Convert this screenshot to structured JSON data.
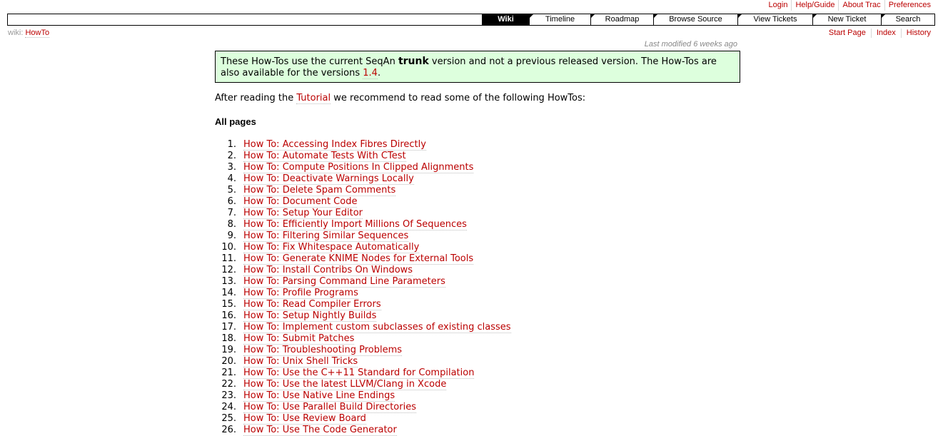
{
  "metanav": [
    {
      "label": "Login"
    },
    {
      "label": "Help/Guide"
    },
    {
      "label": "About Trac"
    },
    {
      "label": "Preferences"
    }
  ],
  "mainnav": [
    {
      "label": "Wiki",
      "active": true,
      "width": 66
    },
    {
      "label": "Timeline",
      "width": 86
    },
    {
      "label": "Roadmap",
      "width": 88
    },
    {
      "label": "Browse Source",
      "width": 118
    },
    {
      "label": "View Tickets",
      "width": 105
    },
    {
      "label": "New Ticket",
      "width": 96
    },
    {
      "label": "Search",
      "width": 75
    }
  ],
  "ctxtnav": {
    "prefix": "wiki:",
    "page": "HowTo",
    "links": [
      {
        "label": "Start Page"
      },
      {
        "label": "Index"
      },
      {
        "label": "History"
      }
    ]
  },
  "last_modified": "Last modified 6 weeks ago",
  "notice": {
    "text1": "These How-Tos use the current SeqAn ",
    "bold": "trunk",
    "text2": " version and not a previous released version. The How-Tos are also available for the versions ",
    "link": "1.4",
    "text3": "."
  },
  "intro": {
    "text1": "After reading the ",
    "link": "Tutorial",
    "text2": " we recommend to read some of the following HowTos:"
  },
  "all_pages_heading": "All pages",
  "howtos": [
    "How To: Accessing Index Fibres Directly",
    "How To: Automate Tests With CTest",
    "How To: Compute Positions In Clipped Alignments",
    "How To: Deactivate Warnings Locally",
    "How To: Delete Spam Comments",
    "How To: Document Code",
    "How To: Setup Your Editor",
    "How To: Efficiently Import Millions Of Sequences",
    "How To: Filtering Similar Sequences",
    "How To: Fix Whitespace Automatically",
    "How To: Generate KNIME Nodes for External Tools",
    "How To: Install Contribs On Windows",
    "How To: Parsing Command Line Parameters",
    "How To: Profile Programs",
    "How To: Read Compiler Errors",
    "How To: Setup Nightly Builds",
    "How To: Implement custom subclasses of existing classes",
    "How To: Submit Patches",
    "How To: Troubleshooting Problems",
    "How To: Unix Shell Tricks",
    "How To: Use the C++11 Standard for Compilation",
    "How To: Use the latest LLVM/Clang in Xcode",
    "How To: Use Native Line Endings",
    "How To: Use Parallel Build Directories",
    "How To: Use Review Board",
    "How To: Use The Code Generator"
  ]
}
